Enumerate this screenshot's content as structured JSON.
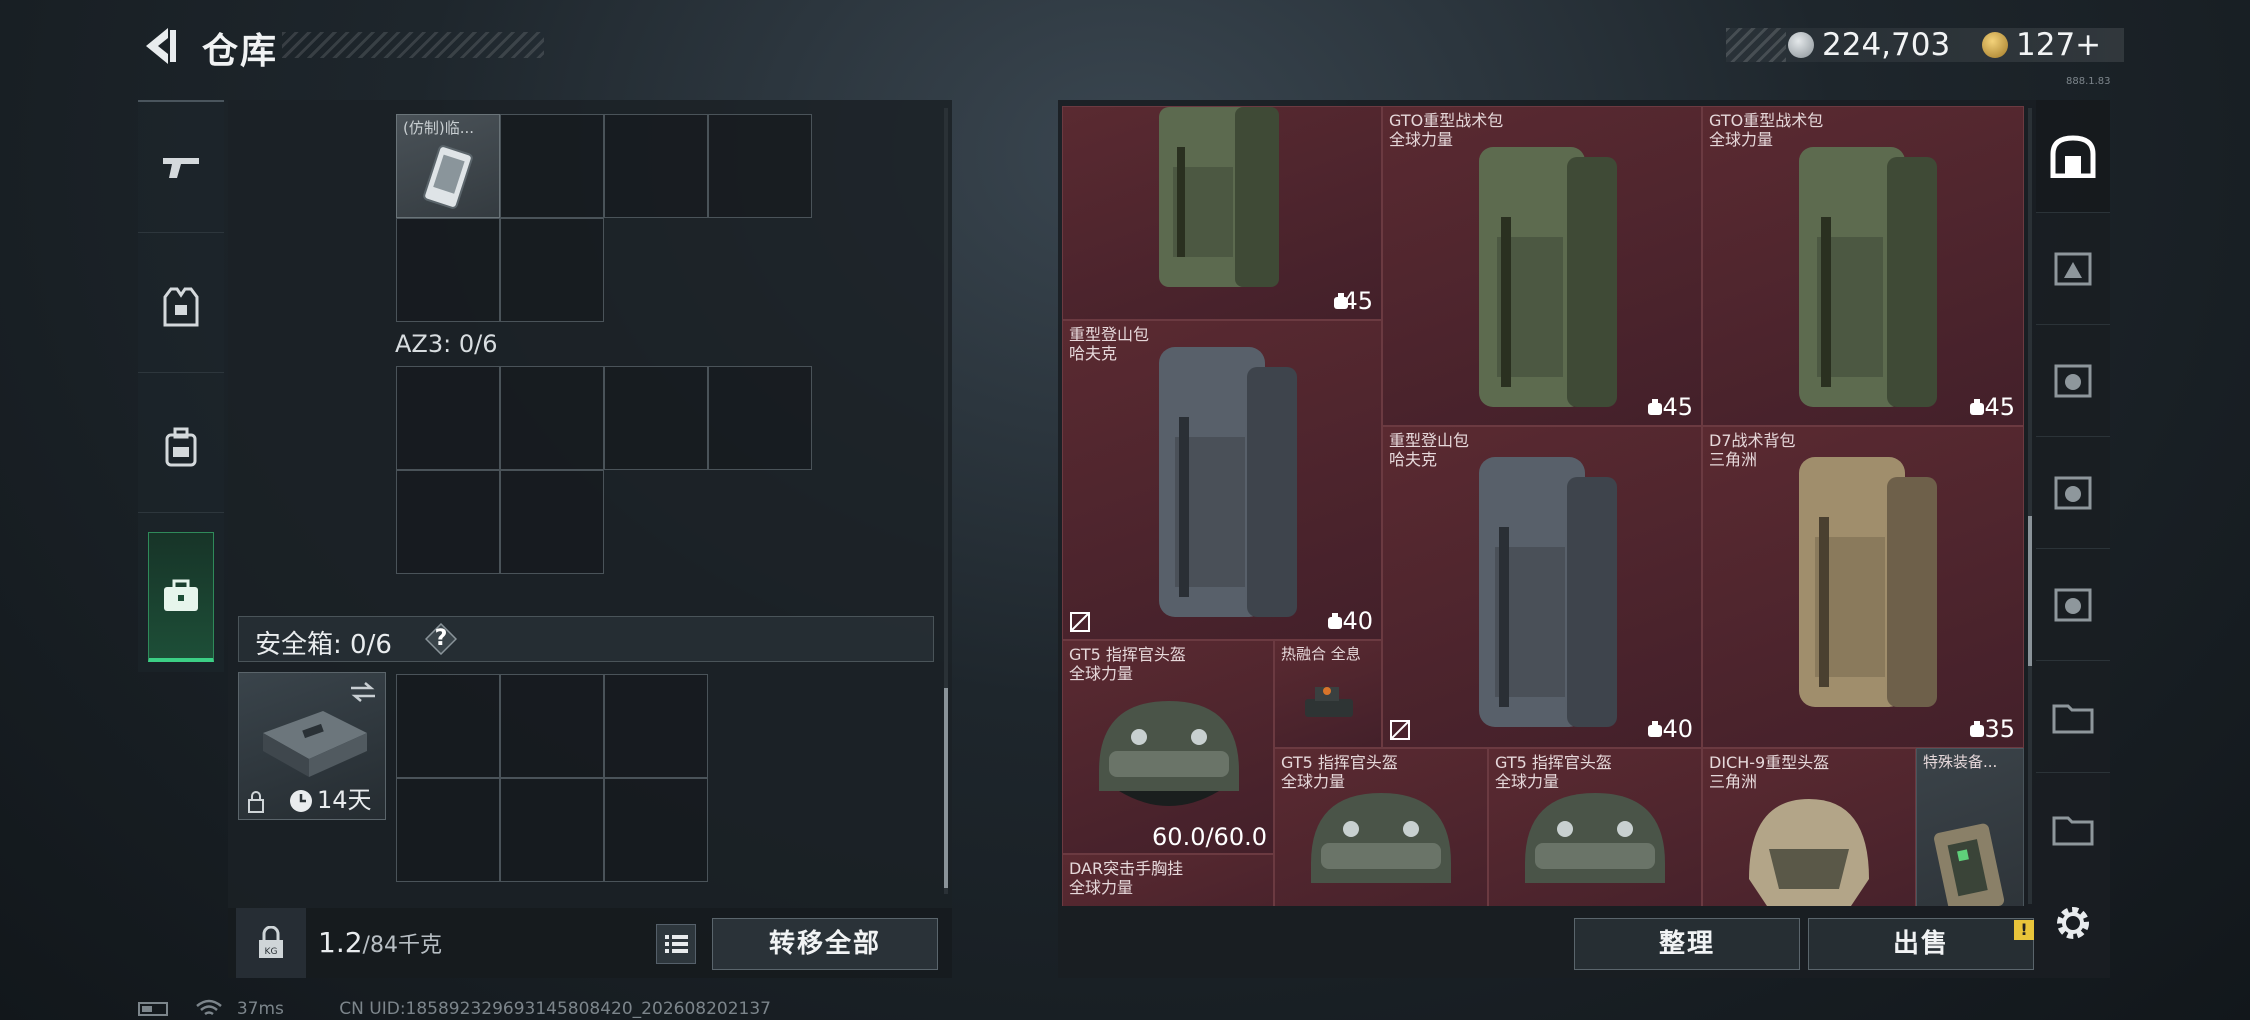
{
  "header": {
    "title": "仓库",
    "currency_primary": "224,703",
    "currency_secondary": "127+",
    "version": "888.1.83"
  },
  "left_tabs": [
    "weapons-icon",
    "armor-icon",
    "backpack-icon",
    "case-icon"
  ],
  "storage": {
    "top_item_name": "(仿制)临...",
    "container_label": "AZ3: 0/6",
    "safebox_label": "安全箱: 0/6",
    "safebox_help": "?",
    "safebox_timer": "14天",
    "weight": "1.2",
    "weight_max": "/84千克",
    "transfer_all": "转移全部"
  },
  "items": [
    {
      "name1": "",
      "name2": "",
      "value": "45"
    },
    {
      "name1": "GTO重型战术包",
      "name2": "全球力量",
      "value": "45"
    },
    {
      "name1": "GTO重型战术包",
      "name2": "全球力量",
      "value": "45"
    },
    {
      "name1": "重型登山包",
      "name2": "哈夫克",
      "value": "40"
    },
    {
      "name1": "重型登山包",
      "name2": "哈夫克",
      "value": "40"
    },
    {
      "name1": "D7战术背包",
      "name2": "三角洲",
      "value": "35"
    },
    {
      "name1": "GT5 指挥官头盔",
      "name2": "全球力量",
      "value": "60.0/60.0"
    },
    {
      "name1": "热融合 全息",
      "name2": "",
      "value": ""
    },
    {
      "name1": "GT5 指挥官头盔",
      "name2": "全球力量",
      "value": ""
    },
    {
      "name1": "GT5 指挥官头盔",
      "name2": "全球力量",
      "value": ""
    },
    {
      "name1": "DICH-9重型头盔",
      "name2": "三角洲",
      "value": ""
    },
    {
      "name1": "特殊装备...",
      "name2": "",
      "value": ""
    },
    {
      "name1": "DAR突击手胸挂",
      "name2": "全球力量",
      "value": ""
    }
  ],
  "actions": {
    "sort": "整理",
    "sell": "出售",
    "warning": "!"
  },
  "status_bar": {
    "ping": "37ms",
    "uid": "CN UID:1858923296931458084​20_202608202137"
  },
  "colors": {
    "accent_green": "#3ccf85",
    "item_bg_red": "#4a2328",
    "warning_yellow": "#e8c43a"
  }
}
